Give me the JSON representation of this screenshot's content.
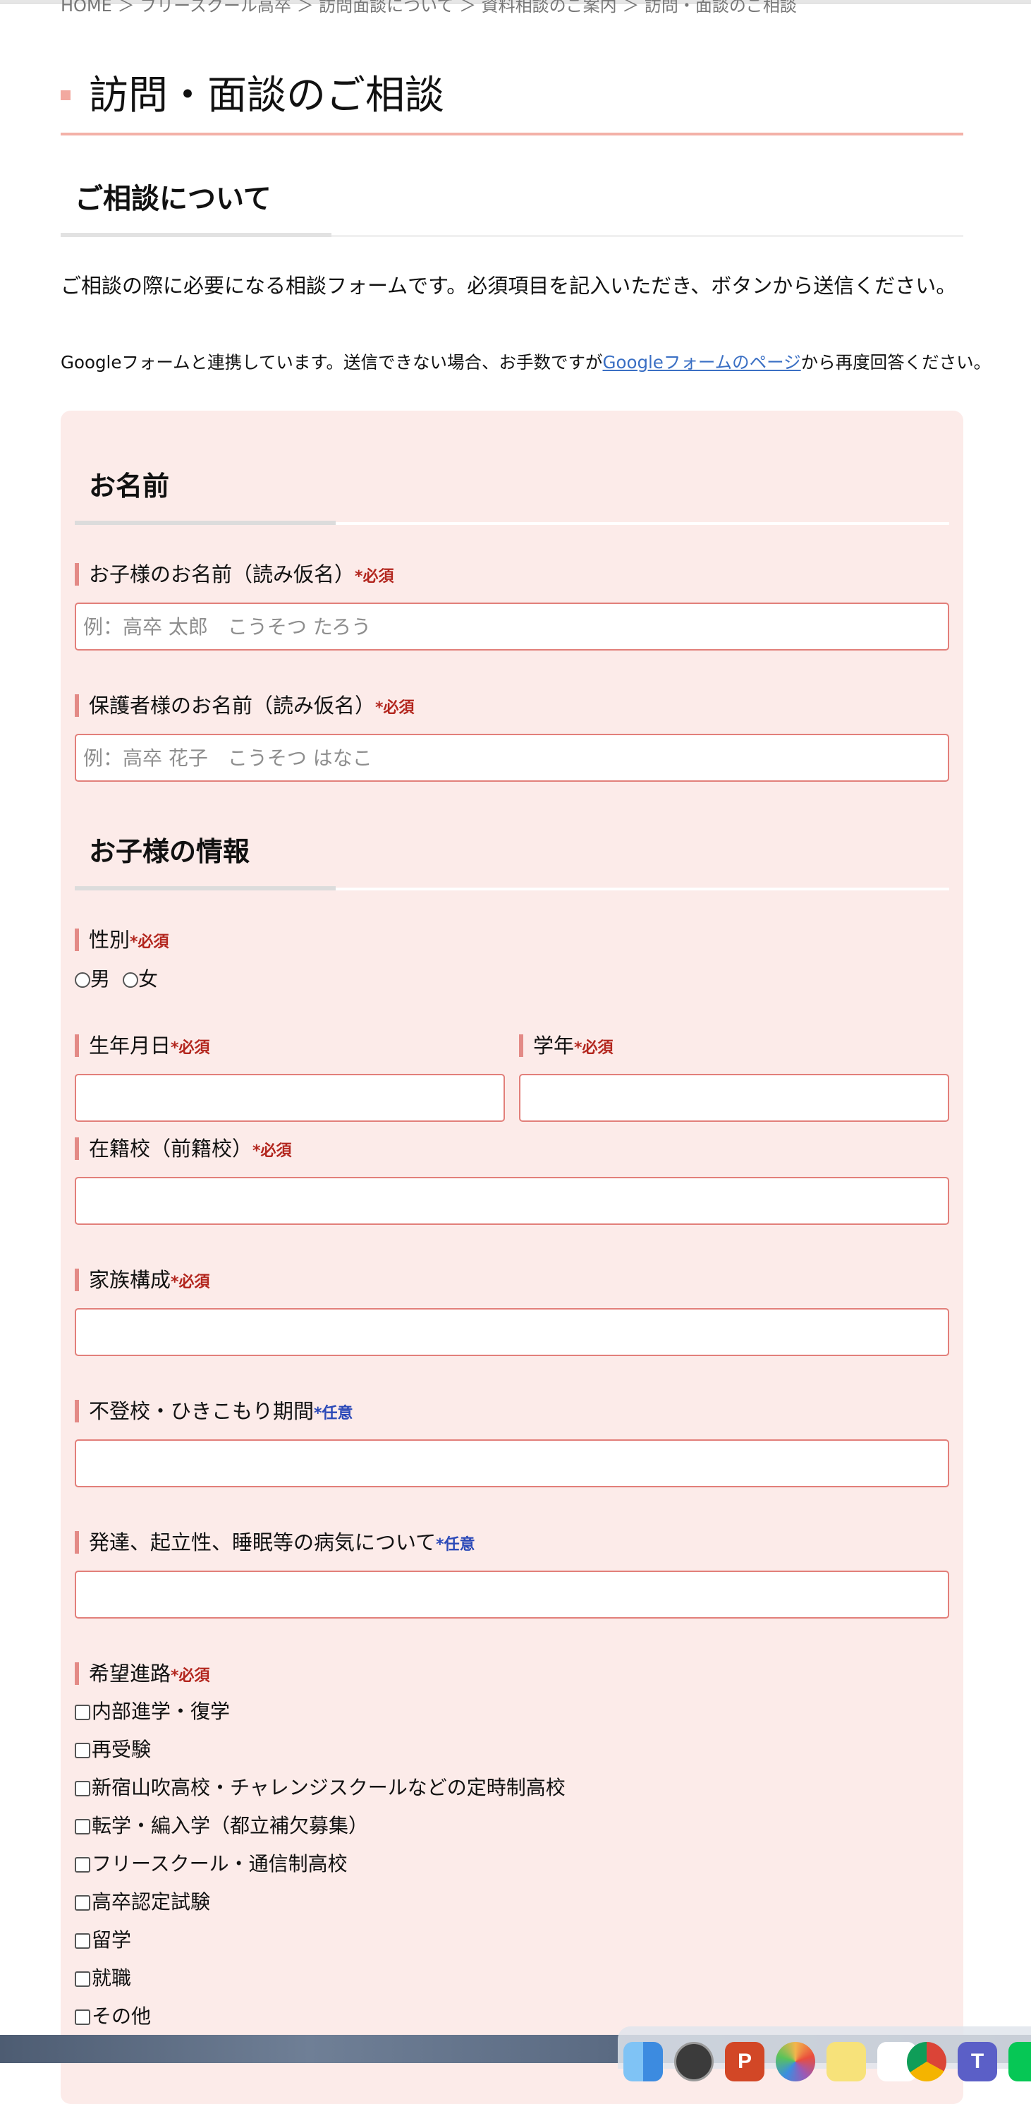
{
  "page": {
    "clipped_top_text": "HOME ＞ フリースクール高卒 ＞ 訪問面談について ＞ 資料相談のご案内 ＞ 訪問・面談のご相談",
    "title": "訪問・面談のご相談"
  },
  "about": {
    "heading": "ご相談について",
    "intro": "ご相談の際に必要になる相談フォームです。必須項目を記入いただき、ボタンから送信ください。",
    "note_before": "Googleフォームと連携しています。送信できない場合、お手数ですが",
    "note_link": "Googleフォームのページ",
    "note_after": "から再度回答ください。"
  },
  "markers": {
    "required": "*必須",
    "optional": "*任意"
  },
  "name_section": {
    "heading": "お名前",
    "child_name_label": "お子様のお名前（読み仮名）",
    "child_name_placeholder": "例：高卒 太郎　こうそつ たろう",
    "parent_name_label": "保護者様のお名前（読み仮名）",
    "parent_name_placeholder": "例：高卒 花子　こうそつ はなこ"
  },
  "child_section": {
    "heading": "お子様の情報",
    "gender_label": "性別",
    "gender_options": [
      "男",
      "女"
    ],
    "birthdate_label": "生年月日",
    "grade_label": "学年",
    "school_label": "在籍校（前籍校）",
    "family_label": "家族構成",
    "absence_label": "不登校・ひきこもり期間",
    "health_label": "発達、起立性、睡眠等の病気について",
    "career_label": "希望進路",
    "career_options": [
      "内部進学・復学",
      "再受験",
      "新宿山吹高校・チャレンジスクールなどの定時制高校",
      "転学・編入学（都立補欠募集）",
      "フリースクール・通信制高校",
      "高卒認定試験",
      "留学",
      "就職",
      "その他"
    ]
  },
  "colors": {
    "title_accent": "#f3b1a8",
    "panel_background": "#fcebe9",
    "field_border": "#e27f7a",
    "label_bar": "#e38a86",
    "required": "#b3261e",
    "optional": "#2b49b8",
    "link": "#3a6fc4"
  },
  "dock": {
    "icons": [
      "finder-icon",
      "safari-icon",
      "powerpoint-icon",
      "photos-icon",
      "notes-icon",
      "chrome-icon",
      "teams-icon",
      "line-icon"
    ]
  }
}
